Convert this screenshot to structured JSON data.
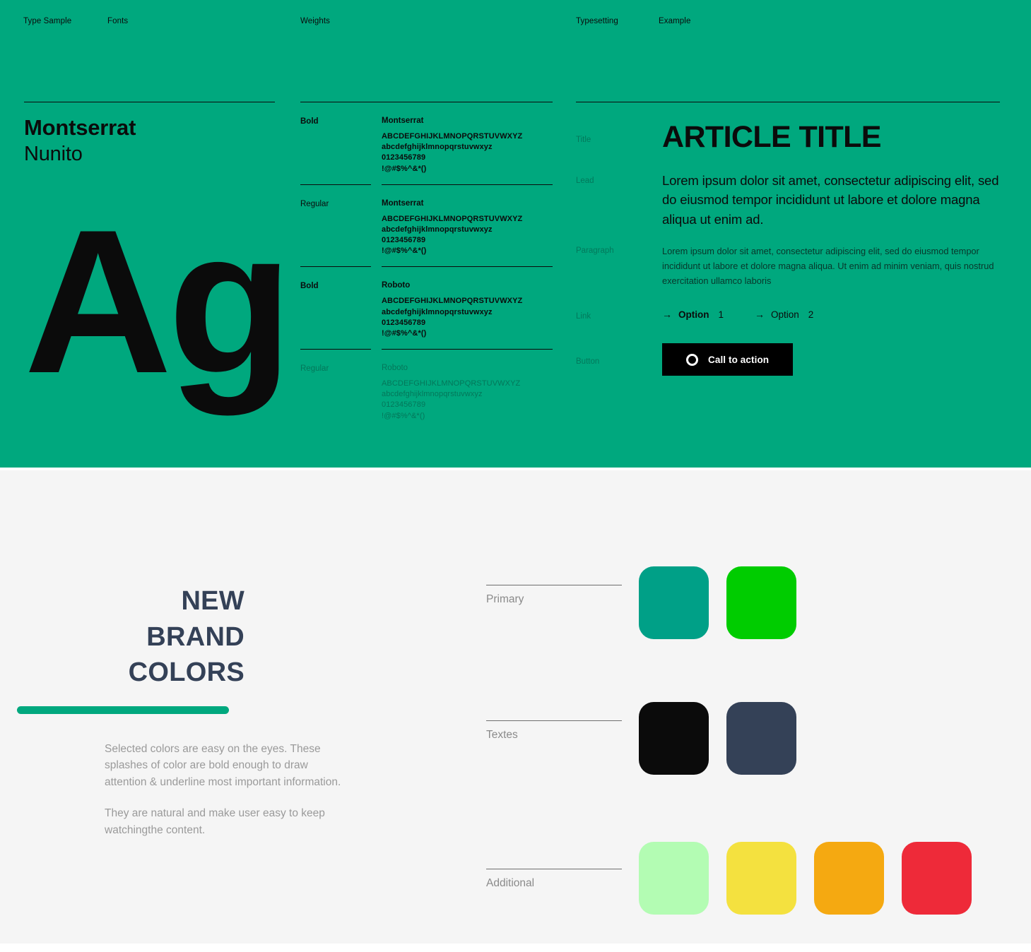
{
  "topbar": {
    "labels": [
      "Type Sample",
      "Fonts",
      "Weights",
      "Typesetting",
      "Example"
    ]
  },
  "fonts": {
    "primary": "Montserrat",
    "secondary": "Nunito",
    "display_sample": "Ag"
  },
  "weights": {
    "rows": [
      {
        "weight": "Bold",
        "font": "Montserrat",
        "uppercase": "ABCDEFGHIJKLMNOPQRSTUVWXYZ",
        "lowercase": "abcdefghijklmnopqrstuvwxyz",
        "numbers": "0123456789",
        "symbols": "!@#$%^&*()"
      },
      {
        "weight": "Regular",
        "font": "Montserrat",
        "uppercase": "ABCDEFGHIJKLMNOPQRSTUVWXYZ",
        "lowercase": "abcdefghijklmnopqrstuvwxyz",
        "numbers": "0123456789",
        "symbols": "!@#$%^&*()"
      },
      {
        "weight": "Bold",
        "font": "Roboto",
        "uppercase": "ABCDEFGHIJKLMNOPQRSTUVWXYZ",
        "lowercase": "abcdefghijklmnopqrstuvwxyz",
        "numbers": "0123456789",
        "symbols": "!@#$%^&*()"
      },
      {
        "weight": "Regular",
        "font": "Roboto",
        "uppercase": "ABCDEFGHIJKLMNOPQRSTUVWXYZ",
        "lowercase": "abcdefghijklmnopqrstuvwxyz",
        "numbers": "0123456789",
        "symbols": "!@#$%^&*()"
      }
    ]
  },
  "typesetting": {
    "title_label": "Title",
    "title_text": "ARTICLE TITLE",
    "lead_label": "Lead",
    "lead_text": "Lorem ipsum dolor sit amet, consectetur adipiscing elit, sed do eiusmod tempor incididunt ut labore et dolore magna aliqua ut enim ad.",
    "paragraph_label": "Paragraph",
    "paragraph_text": "Lorem ipsum dolor sit amet, consectetur adipiscing elit, sed do eiusmod tempor incididunt ut labore et dolore magna aliqua. Ut enim ad minim veniam, quis nostrud exercitation ullamco laboris",
    "link_label": "Link",
    "links": [
      {
        "arrow": "→",
        "text": "Option",
        "num": "1"
      },
      {
        "arrow": "→",
        "text": "Option",
        "num": "2"
      }
    ],
    "button_label": "Button",
    "button_text": "Call to action",
    "button_icon": "circle-ring-icon"
  },
  "brand": {
    "heading_line1": "NEW",
    "heading_line2": "BRAND",
    "heading_line3": "COLORS",
    "paragraph1": "Selected colors are easy on the eyes. These splashes of color are bold enough to draw attention & underline most important information.",
    "paragraph2": "They are natural and make user easy to keep watchingthe content.",
    "underline_color": "#00A87E",
    "heading_color": "#344157"
  },
  "palette": {
    "rows": [
      {
        "label": "Primary",
        "colors": [
          "#00A087",
          "#00CC00"
        ]
      },
      {
        "label": "Textes",
        "colors": [
          "#0B0B0B",
          "#344157"
        ]
      },
      {
        "label": "Additional",
        "colors": [
          "#B3FCB3",
          "#F4E13F",
          "#F5A911",
          "#EE2A39"
        ]
      }
    ]
  },
  "theme": {
    "green_background": "#00A87E",
    "light_background": "#F5F5F5"
  }
}
